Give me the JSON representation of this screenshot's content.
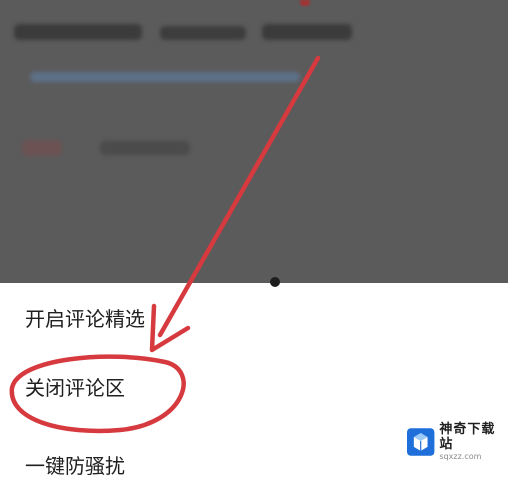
{
  "menu": {
    "items": [
      {
        "label": "开启评论精选"
      },
      {
        "label": "关闭评论区"
      },
      {
        "label": "一键防骚扰"
      }
    ]
  },
  "annotation": {
    "color": "#d63a3f",
    "arrow_icon": "arrow-icon",
    "circle_icon": "ellipse-highlight"
  },
  "watermark": {
    "name": "神奇下载站",
    "url": "sqxzz.com"
  }
}
